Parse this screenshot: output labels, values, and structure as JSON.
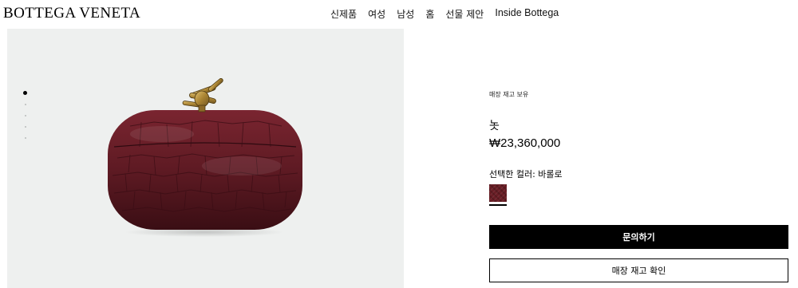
{
  "header": {
    "logo": "BOTTEGA VENETA",
    "nav": [
      "신제품",
      "여성",
      "남성",
      "홈",
      "선물 제안",
      "Inside Bottega"
    ]
  },
  "gallery": {
    "image_count": 5,
    "active_index": 0,
    "background": "#eef0ef"
  },
  "product": {
    "stock_note": "매장 재고 보유",
    "name": "놋",
    "price": "₩23,360,000",
    "color_label": "선택한 컬러: 바롤로",
    "swatch_color": "#6a1e26",
    "inquire_label": "문의하기",
    "check_stock_label": "매장 재고 확인"
  }
}
